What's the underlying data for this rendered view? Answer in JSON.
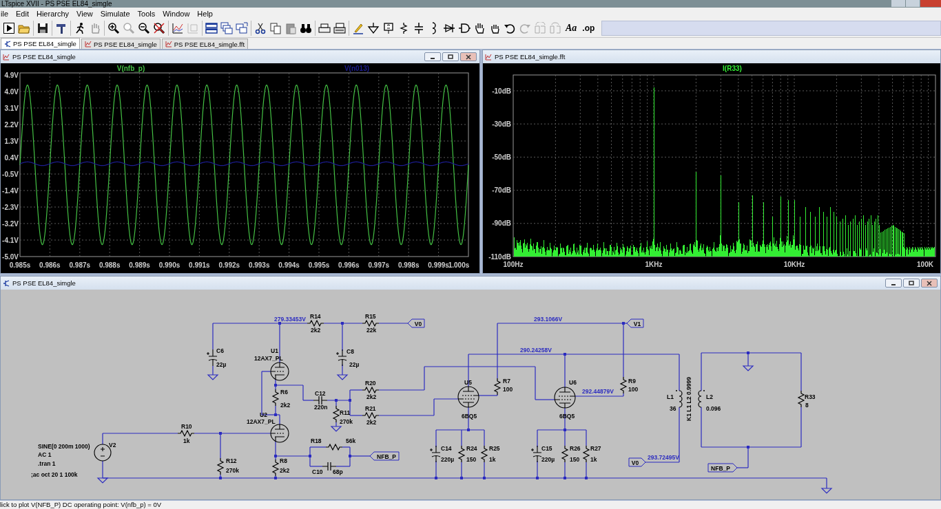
{
  "window": {
    "title": "LTspice XVII - PS PSE EL84_simgle"
  },
  "menu": [
    "ile",
    "Edit",
    "Hierarchy",
    "View",
    "Simulate",
    "Tools",
    "Window",
    "Help"
  ],
  "toolbar": {
    "text_buttons": [
      "Aa",
      ".op"
    ]
  },
  "tabs": [
    {
      "label": "PS PSE EL84_simgle",
      "kind": "schematic",
      "selected": true
    },
    {
      "label": "PS PSE EL84_simgle",
      "kind": "waveform",
      "selected": false
    },
    {
      "label": "PS PSE EL84_simgle.fft",
      "kind": "waveform",
      "selected": false
    }
  ],
  "plots": [
    {
      "title": "PS PSE EL84_simgle",
      "kind": "transient",
      "traces": [
        {
          "name": "V(nfb_p)",
          "color": "#44c044"
        },
        {
          "name": "V(n013)",
          "color": "#1c1c90"
        }
      ],
      "y_labels": [
        "4.9V",
        "4.0V",
        "3.1V",
        "2.2V",
        "1.3V",
        "0.4V",
        "-0.5V",
        "-1.4V",
        "-2.3V",
        "-3.2V",
        "-4.1V",
        "-5.0V"
      ],
      "x_labels": [
        "0.985s",
        "0.986s",
        "0.987s",
        "0.988s",
        "0.989s",
        "0.990s",
        "0.991s",
        "0.992s",
        "0.993s",
        "0.994s",
        "0.995s",
        "0.996s",
        "0.997s",
        "0.998s",
        "0.999s",
        "1.000s"
      ]
    },
    {
      "title": "PS PSE EL84_simgle.fft",
      "kind": "fft",
      "traces": [
        {
          "name": "I(R33)",
          "color": "#33ee33"
        }
      ],
      "y_labels": [
        "-10dB",
        "-30dB",
        "-50dB",
        "-70dB",
        "-90dB",
        "-110dB"
      ],
      "x_labels": [
        "100Hz",
        "1KHz",
        "10KHz",
        "100K"
      ]
    }
  ],
  "schematic": {
    "title": "PS PSE EL84_simgle",
    "components": [
      {
        "kind": "polar_capacitor",
        "name": "C6",
        "value": "22µ"
      },
      {
        "kind": "triode",
        "name": "U1",
        "value": "12AX7_PL"
      },
      {
        "kind": "resistor",
        "name": "R14",
        "value": "2k2"
      },
      {
        "kind": "resistor",
        "name": "R15",
        "value": "22k"
      },
      {
        "kind": "polar_capacitor",
        "name": "C8",
        "value": "22µ"
      },
      {
        "kind": "resistor",
        "name": "R6",
        "value": "2k2"
      },
      {
        "kind": "capacitor",
        "name": "C12",
        "value": "220n"
      },
      {
        "kind": "resistor",
        "name": "R20",
        "value": "2k2"
      },
      {
        "kind": "resistor",
        "name": "R10",
        "value": "1k"
      },
      {
        "kind": "triode",
        "name": "U2",
        "value": "12AX7_PL"
      },
      {
        "kind": "resistor",
        "name": "R11",
        "value": "270k"
      },
      {
        "kind": "resistor",
        "name": "R21",
        "value": "2k2"
      },
      {
        "kind": "voltage_source",
        "name": "V2"
      },
      {
        "kind": "resistor",
        "name": "R12",
        "value": "270k"
      },
      {
        "kind": "resistor",
        "name": "R8",
        "value": "2k2"
      },
      {
        "kind": "resistor",
        "name": "R18",
        "value": "56k"
      },
      {
        "kind": "capacitor",
        "name": "C10",
        "value": "68p"
      },
      {
        "kind": "pentode",
        "name": "U5",
        "value": "6BQ5"
      },
      {
        "kind": "resistor",
        "name": "R7",
        "value": "100"
      },
      {
        "kind": "pentode",
        "name": "U6",
        "value": "6BQ5"
      },
      {
        "kind": "resistor",
        "name": "R9",
        "value": "100"
      },
      {
        "kind": "polar_capacitor",
        "name": "C14",
        "value": "220µ"
      },
      {
        "kind": "resistor",
        "name": "R24",
        "value": "150"
      },
      {
        "kind": "resistor",
        "name": "R25",
        "value": "1k"
      },
      {
        "kind": "polar_capacitor",
        "name": "C15",
        "value": "220µ"
      },
      {
        "kind": "resistor",
        "name": "R26",
        "value": "150"
      },
      {
        "kind": "resistor",
        "name": "R27",
        "value": "1k"
      },
      {
        "kind": "inductor",
        "name": "L1",
        "value": "36"
      },
      {
        "kind": "inductor",
        "name": "L2",
        "value": "0.096"
      },
      {
        "kind": "resistor",
        "name": "R33",
        "value": "8"
      }
    ],
    "node_voltages": [
      "279.33453V",
      "293.1066V",
      "290.24258V",
      "292.44879V",
      "293.72495V"
    ],
    "net_labels": [
      "V0",
      "V1",
      "NFB_P",
      "V0",
      "NFB_P"
    ],
    "directives": [
      "SINE(0 200m 1000)",
      "AC 1",
      ".tran 1",
      ";ac oct 20 1 100k"
    ],
    "coupling": "K1 L1 L2 0.9999"
  },
  "status_bar": "lick to plot V(NFB_P)  DC operating point: V(nfb_p) = 0V"
}
